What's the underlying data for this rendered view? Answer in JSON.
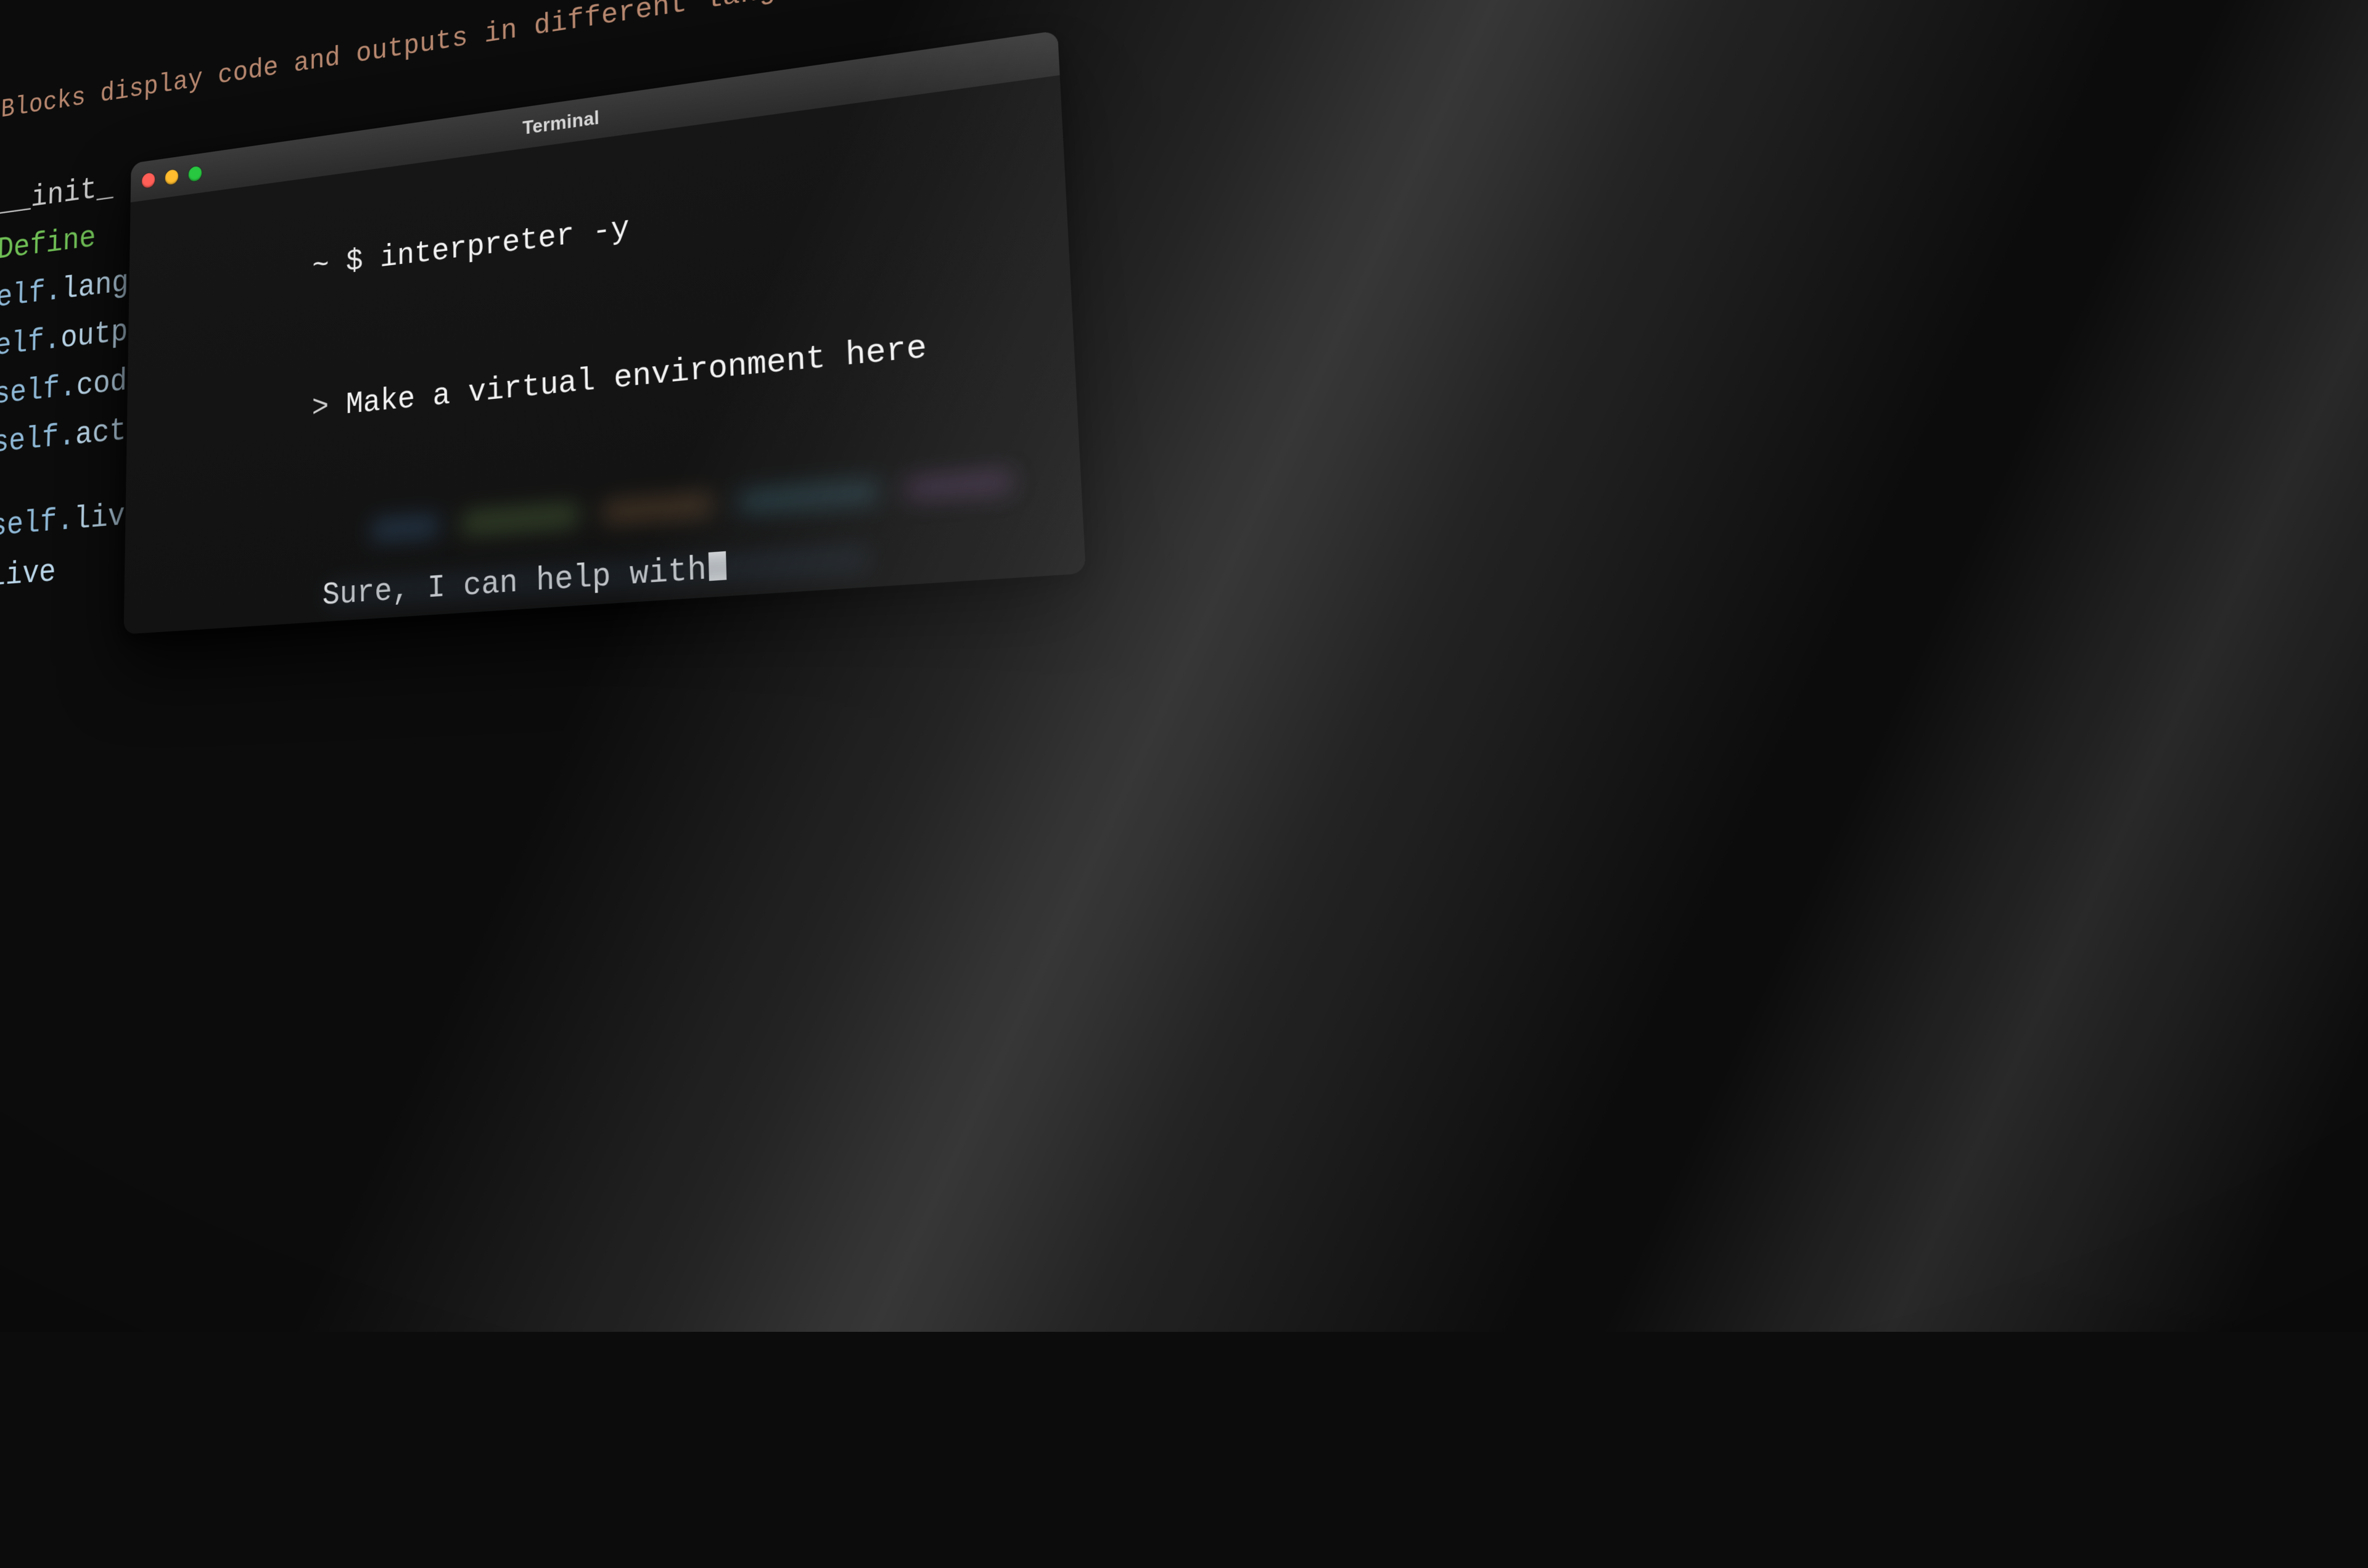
{
  "editor": {
    "comment": "Blocks display code and outputs in different languages.",
    "lines": [
      {
        "kind": "dunder",
        "text": "__init_"
      },
      {
        "kind": "kw",
        "text": "Define "
      },
      {
        "kind": "attr",
        "prefix": "elf.",
        "name": "lang"
      },
      {
        "kind": "attr",
        "prefix": "elf.",
        "name": "outp"
      },
      {
        "kind": "attr",
        "prefix": "self.",
        "name": "code"
      },
      {
        "kind": "attr",
        "prefix": "self.",
        "name": "acti"
      },
      {
        "kind": "gap"
      },
      {
        "kind": "attr",
        "prefix": "self.",
        "name": "live"
      },
      {
        "kind": "attr",
        "prefix": "",
        "name": "live"
      }
    ]
  },
  "terminal": {
    "title": "Terminal",
    "prompt_prefix": "~ $ ",
    "command": "interpreter -y",
    "input_prefix": "> ",
    "user_input": "Make a virtual environment here",
    "reply_partial": "Sure, I can help with"
  }
}
